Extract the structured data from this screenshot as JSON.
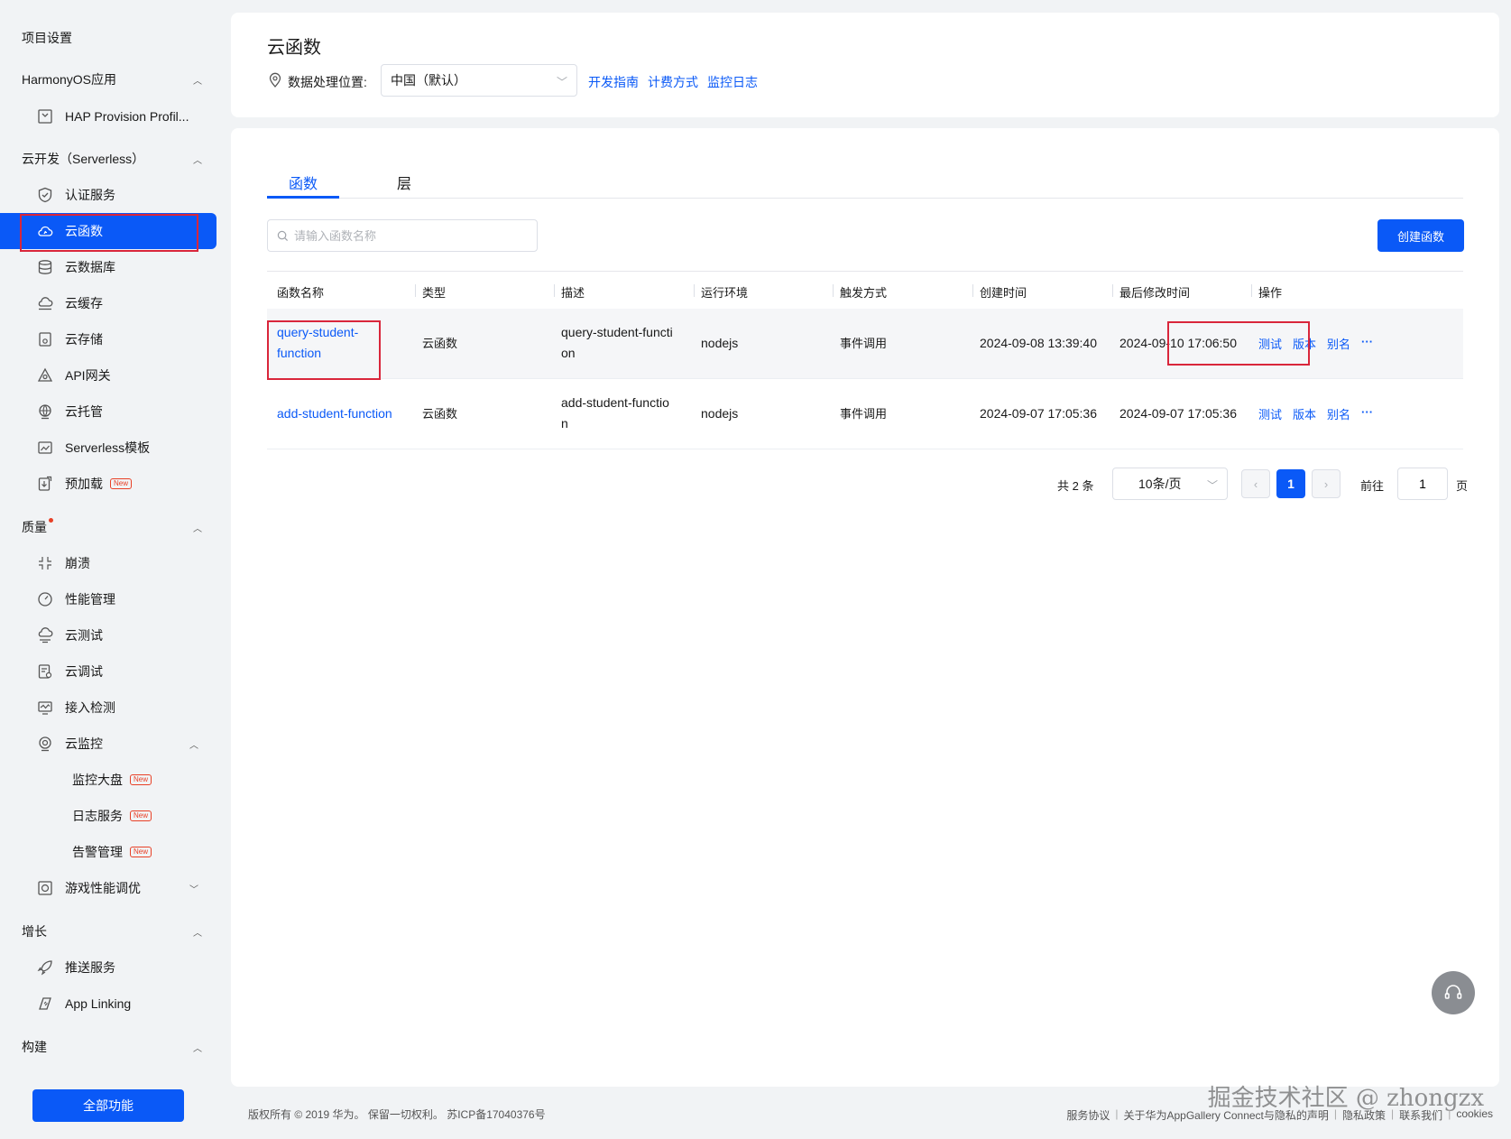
{
  "sidebar": {
    "title": "项目设置",
    "sections": {
      "harmony": "HarmonyOS应用",
      "serverless": "云开发（Serverless）",
      "quality": "质量",
      "growth": "增长",
      "build": "构建"
    },
    "items": {
      "hap": "HAP Provision Profil...",
      "auth": "认证服务",
      "cloud_function": "云函数",
      "cloud_db": "云数据库",
      "cloud_cache": "云缓存",
      "cloud_storage": "云存储",
      "api_gateway": "API网关",
      "cloud_hosting": "云托管",
      "serverless_template": "Serverless模板",
      "preload": "预加载",
      "crash": "崩溃",
      "perf": "性能管理",
      "cloud_test": "云测试",
      "cloud_debug": "云调试",
      "access_detect": "接入检测",
      "cloud_monitor": "云监控",
      "monitor_dashboard": "监控大盘",
      "log_service": "日志服务",
      "alert_mgmt": "告警管理",
      "game_perf": "游戏性能调优",
      "push": "推送服务",
      "app_linking": "App Linking"
    },
    "new_badge": "New",
    "all_features": "全部功能"
  },
  "header": {
    "title": "云函数",
    "location_label": "数据处理位置:",
    "location_value": "中国（默认）",
    "links": [
      "开发指南",
      "计费方式",
      "监控日志"
    ]
  },
  "tabs": [
    "函数",
    "层"
  ],
  "search": {
    "placeholder": "请输入函数名称"
  },
  "create_button": "创建函数",
  "table": {
    "headers": [
      "函数名称",
      "类型",
      "描述",
      "运行环境",
      "触发方式",
      "创建时间",
      "最后修改时间",
      "操作"
    ],
    "rows": [
      {
        "name": [
          "query-student-",
          "function"
        ],
        "type": "云函数",
        "desc": [
          "query-student-functi",
          "on"
        ],
        "runtime": "nodejs",
        "trigger": "事件调用",
        "created": "2024-09-08 13:39:40",
        "modified": "2024-09-10 17:06:50"
      },
      {
        "name": [
          "add-student-function"
        ],
        "type": "云函数",
        "desc": [
          "add-student-functio",
          "n"
        ],
        "runtime": "nodejs",
        "trigger": "事件调用",
        "created": "2024-09-07 17:05:36",
        "modified": "2024-09-07 17:05:36"
      }
    ],
    "ops": [
      "测试",
      "版本",
      "别名",
      "···"
    ]
  },
  "pagination": {
    "total": "共 2 条",
    "page_size": "10条/页",
    "current": "1",
    "goto_label": "前往",
    "goto_value": "1",
    "page_suffix": "页",
    "prev": "‹",
    "next": "›"
  },
  "footer": {
    "copyright": "版权所有 © 2019 华为。 保留一切权利。 苏ICP备17040376号",
    "links": [
      "服务协议",
      "关于华为AppGallery Connect与隐私的声明",
      "隐私政策",
      "联系我们",
      "cookies"
    ]
  },
  "watermark": "掘金技术社区 @ zhongzx"
}
